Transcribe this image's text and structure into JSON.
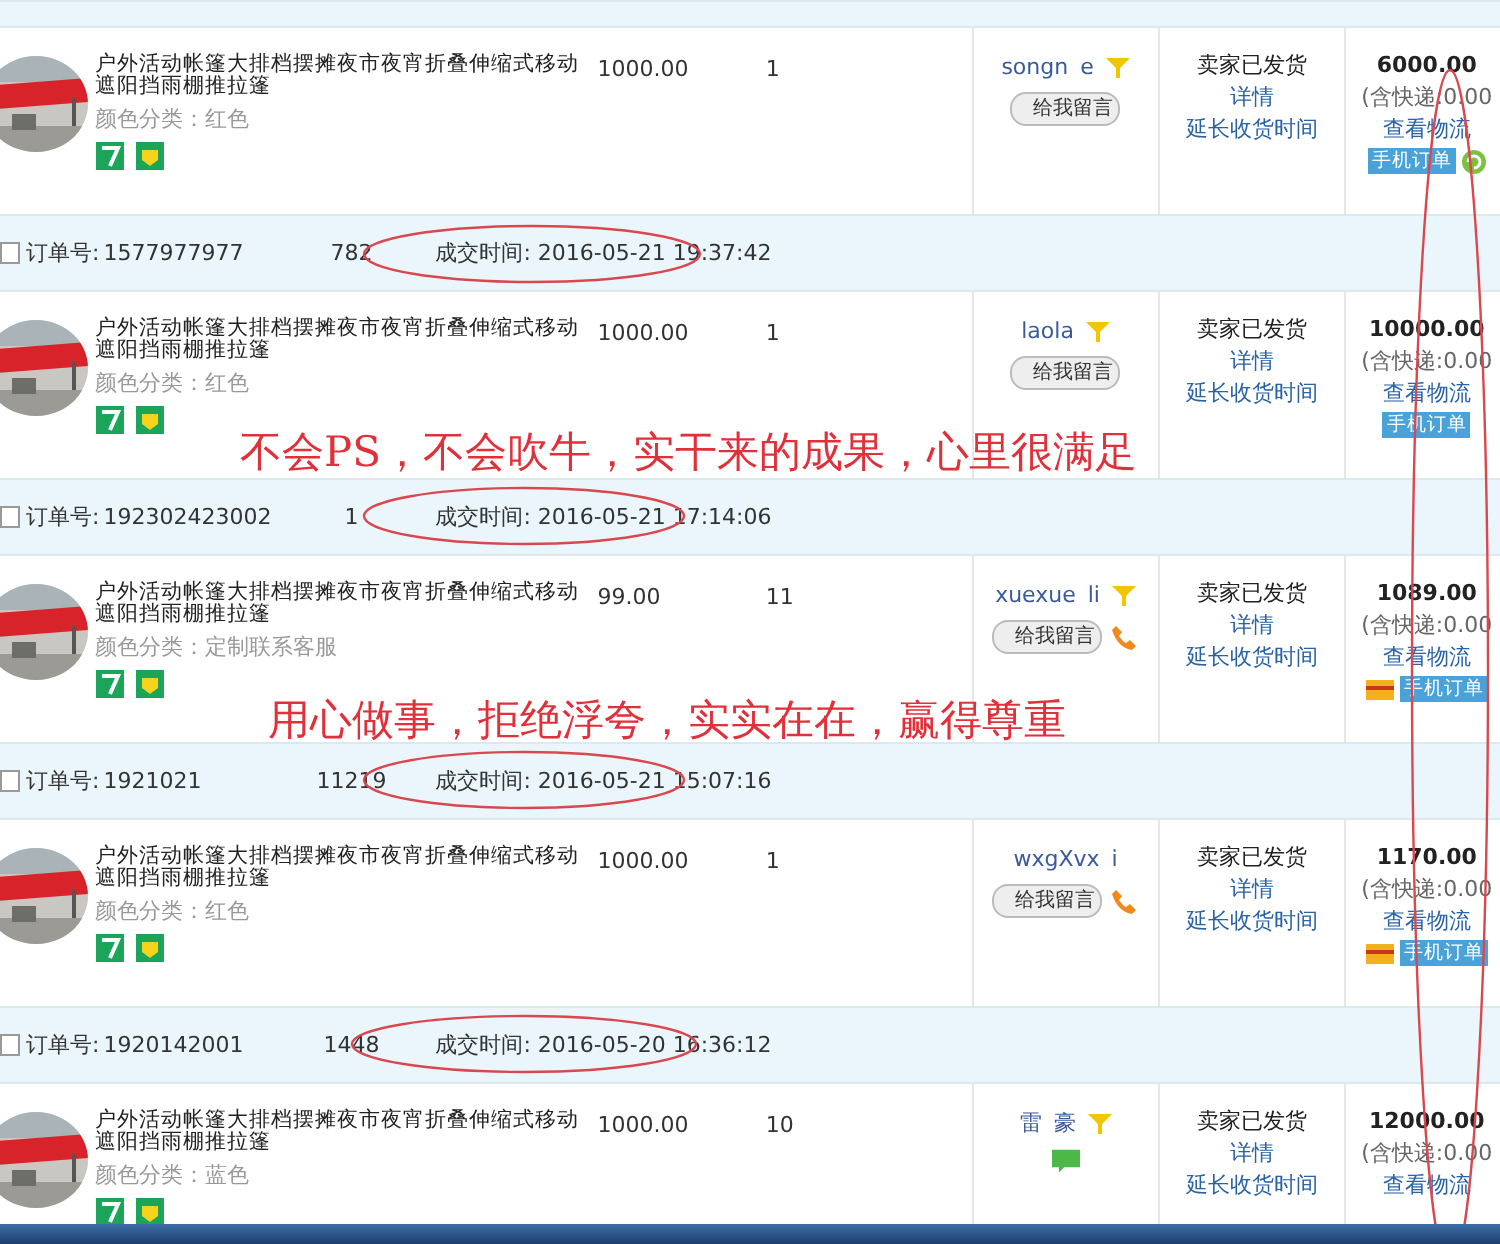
{
  "orders": [
    {
      "title": "户外活动帐篷大排档摆摊夜市夜宵折叠伸缩式移动遮阳挡雨棚推拉篷",
      "variant": "颜色分类：红色",
      "price": "1000.00",
      "qty": "1",
      "buyer": [
        "songn",
        "e"
      ],
      "buyer_icons": [
        {
          "kind": "funnel"
        }
      ],
      "message": "给我留言",
      "status": "卖家已发货",
      "details": "详情",
      "extend": "延长收货时间",
      "total": "6000.00",
      "shipping": "(含快递:0.00",
      "logistics": "查看物流",
      "mobile": "手机订单",
      "tag_icons": [
        {
          "kind": "refresh"
        }
      ]
    },
    {
      "checked": false,
      "order_no": [
        "1577977977",
        "782"
      ],
      "time": "成交时间: 2016-05-21 19:37:42",
      "title": "户外活动帐篷大排档摆摊夜市夜宵折叠伸缩式移动遮阳挡雨棚推拉篷",
      "variant": "颜色分类：红色",
      "price": "1000.00",
      "qty": "1",
      "buyer": [
        "laola"
      ],
      "buyer_icons": [
        {
          "kind": "funnel"
        }
      ],
      "message": "给我留言",
      "status": "卖家已发货",
      "details": "详情",
      "extend": "延长收货时间",
      "total": "10000.00",
      "shipping": "(含快递:0.00",
      "logistics": "查看物流",
      "mobile": "手机订单"
    },
    {
      "checked": false,
      "order_no": [
        "192302423002",
        "1"
      ],
      "time": "成交时间: 2016-05-21 17:14:06",
      "title": "户外活动帐篷大排档摆摊夜市夜宵折叠伸缩式移动遮阳挡雨棚推拉篷",
      "variant": "颜色分类：定制联系客服",
      "price": "99.00",
      "qty": "11",
      "buyer": [
        "xuexue",
        "li"
      ],
      "buyer_icons": [
        {
          "kind": "funnel"
        }
      ],
      "message": "给我留言",
      "contact_icons": [
        {
          "kind": "phone"
        }
      ],
      "status": "卖家已发货",
      "details": "详情",
      "extend": "延长收货时间",
      "total": "1089.00",
      "shipping": "(含快递:0.00",
      "logistics": "查看物流",
      "mobile": "手机订单",
      "tag_icons": [
        {
          "kind": "card"
        }
      ]
    },
    {
      "checked": false,
      "order_no": [
        "1921021",
        "11219"
      ],
      "time": "成交时间: 2016-05-21 15:07:16",
      "title": "户外活动帐篷大排档摆摊夜市夜宵折叠伸缩式移动遮阳挡雨棚推拉篷",
      "variant": "颜色分类：红色",
      "price": "1000.00",
      "qty": "1",
      "buyer": [
        "wxgXvx",
        "i"
      ],
      "message": "给我留言",
      "contact_icons": [
        {
          "kind": "phone"
        }
      ],
      "status": "卖家已发货",
      "details": "详情",
      "extend": "延长收货时间",
      "total": "1170.00",
      "shipping": "(含快递:0.00",
      "logistics": "查看物流",
      "mobile": "手机订单",
      "tag_icons": [
        {
          "kind": "card"
        }
      ]
    },
    {
      "checked": false,
      "order_no": [
        "1920142001",
        "1448"
      ],
      "time": "成交时间: 2016-05-20 16:36:12",
      "title": "户外活动帐篷大排档摆摊夜市夜宵折叠伸缩式移动遮阳挡雨棚推拉篷",
      "variant": "颜色分类：蓝色",
      "price": "1000.00",
      "qty": "10",
      "buyer": [
        "雷",
        "豪"
      ],
      "buyer_icons": [
        {
          "kind": "funnel"
        }
      ],
      "contact_icons": [
        {
          "kind": "chat"
        }
      ],
      "status": "卖家已发货",
      "details": "详情",
      "extend": "延长收货时间",
      "total": "12000.00",
      "shipping": "(含快递:0.00",
      "logistics": "查看物流"
    }
  ],
  "order_no_label": [
    "订单号:",
    "订单号:",
    "订单号:",
    "订单号:"
  ],
  "annotations": [
    "不会PS，不会吹牛，实干来的成果，心里很满足",
    "用心做事，拒绝浮夸，实实在在，赢得尊重"
  ]
}
